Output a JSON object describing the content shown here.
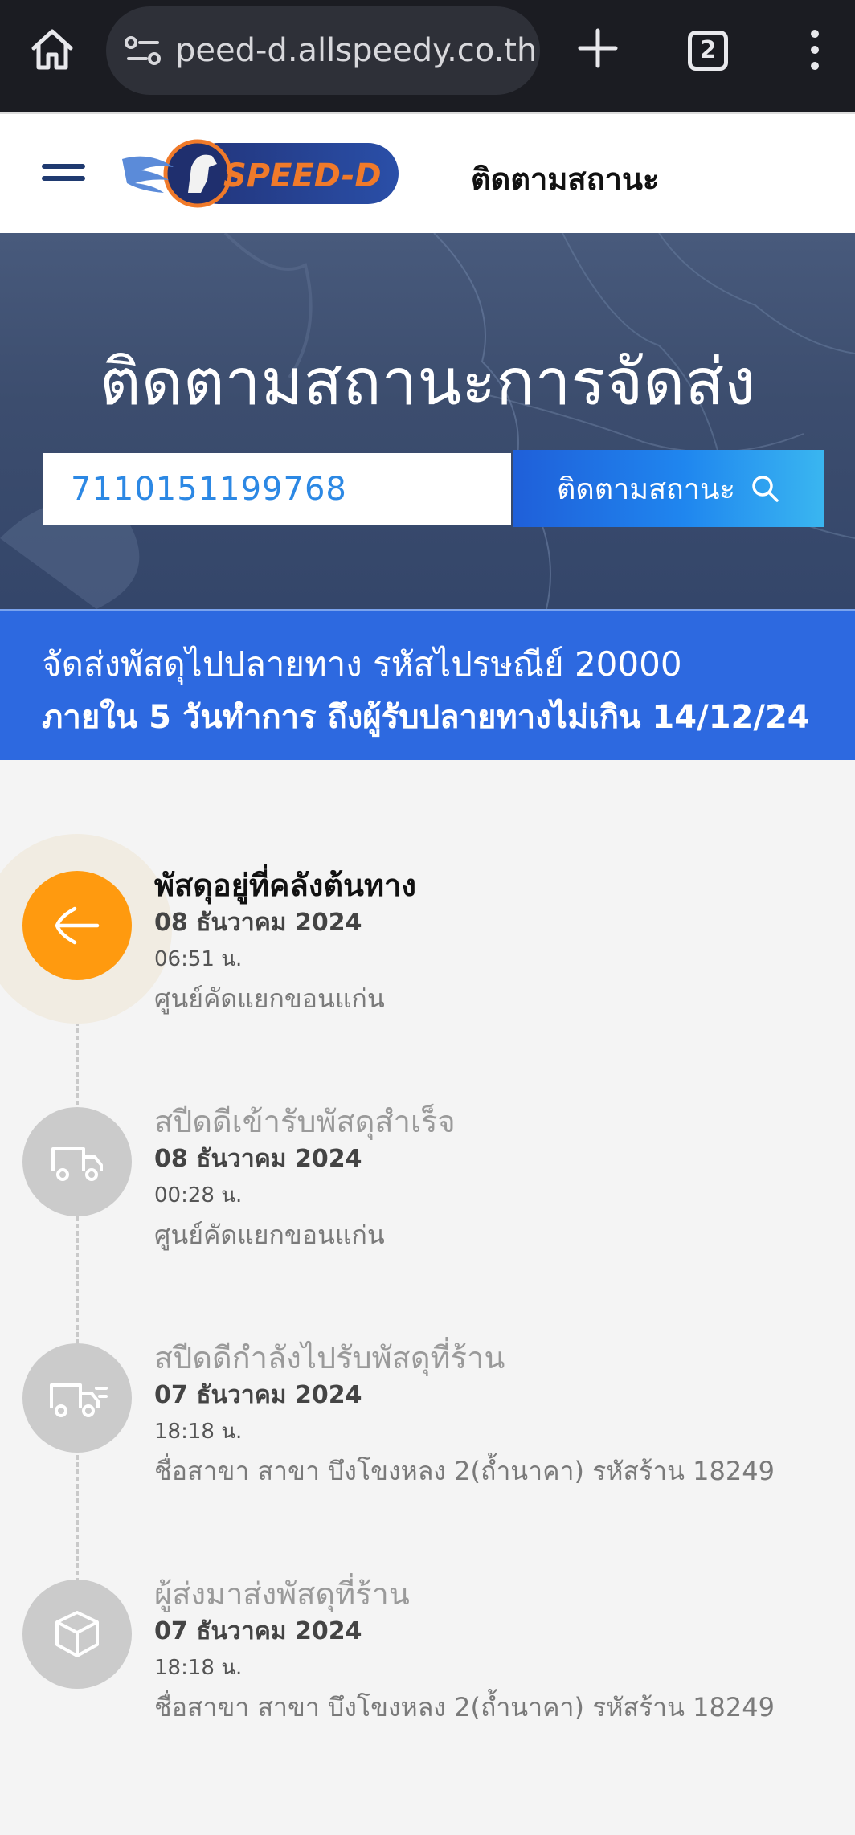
{
  "browser": {
    "url": "peed-d.allspeedy.co.th",
    "tab_count": "2"
  },
  "header": {
    "logo_text": "SPEED-D",
    "nav_link": "ติดตามสถานะ"
  },
  "hero": {
    "title": "ติดตามสถานะการจัดส่ง",
    "tracking_number": "7110151199768",
    "search_button": "ติดตามสถานะ"
  },
  "banner": {
    "line1": "จัดส่งพัสดุไปปลายทาง รหัสไปรษณีย์ 20000",
    "line2": "ภายใน 5 วันทำการ ถึงผู้รับปลายทางไม่เกิน 14/12/24"
  },
  "timeline": [
    {
      "title": "พัสดุอยู่ที่คลังต้นทาง",
      "date": "08 ธันวาคม 2024",
      "time": "06:51 น.",
      "location": "ศูนย์คัดแยกขอนแก่น",
      "icon": "arrow-left-icon",
      "active": true
    },
    {
      "title": "สปีดดีเข้ารับพัสดุสำเร็จ",
      "date": "08 ธันวาคม 2024",
      "time": "00:28 น.",
      "location": "ศูนย์คัดแยกขอนแก่น",
      "icon": "truck-icon",
      "active": false
    },
    {
      "title": "สปีดดีกำลังไปรับพัสดุที่ร้าน",
      "date": "07 ธันวาคม 2024",
      "time": "18:18 น.",
      "location": "ชื่อสาขา สาขา บึงโขงหลง 2(ถ้ำนาคา) รหัสร้าน 18249",
      "icon": "fast-truck-icon",
      "active": false
    },
    {
      "title": "ผู้ส่งมาส่งพัสดุที่ร้าน",
      "date": "07 ธันวาคม 2024",
      "time": "18:18 น.",
      "location": "ชื่อสาขา สาขา บึงโขงหลง 2(ถ้ำนาคา) รหัสร้าน 18249",
      "icon": "box-icon",
      "active": false
    }
  ],
  "colors": {
    "active_step": "#ff9a0f",
    "inactive_step": "#cbcbcb",
    "banner": "#2d69e0",
    "link_blue": "#2c88e4"
  }
}
